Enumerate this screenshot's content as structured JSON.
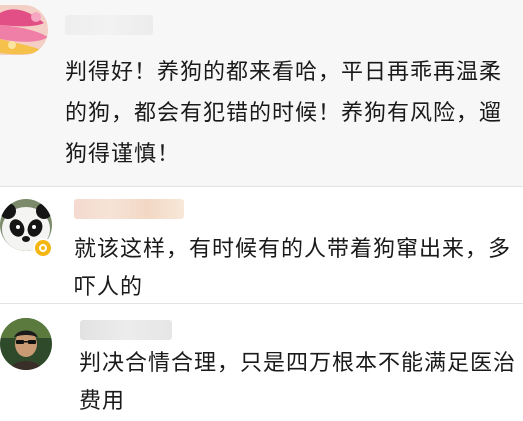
{
  "comments": [
    {
      "avatar": "flower-avatar",
      "username": "",
      "text": "判得好！养狗的都来看哈，平日再乖再温柔的狗，都会有犯错的时候！养狗有风险，遛狗得谨慎！"
    },
    {
      "avatar": "panda-avatar",
      "username": "",
      "verified_badge": "verified-badge-icon",
      "text": "就该这样，有时候有的人带着狗窜出来，多吓人的"
    },
    {
      "avatar": "person-avatar",
      "username": "",
      "text": "判决合情合理，只是四万根本不能满足医治费用"
    }
  ],
  "colors": {
    "highlight_background": "#f7f7f7",
    "divider": "#e3e3e3",
    "badge": "#f5b614",
    "text": "#1a1a1a"
  }
}
